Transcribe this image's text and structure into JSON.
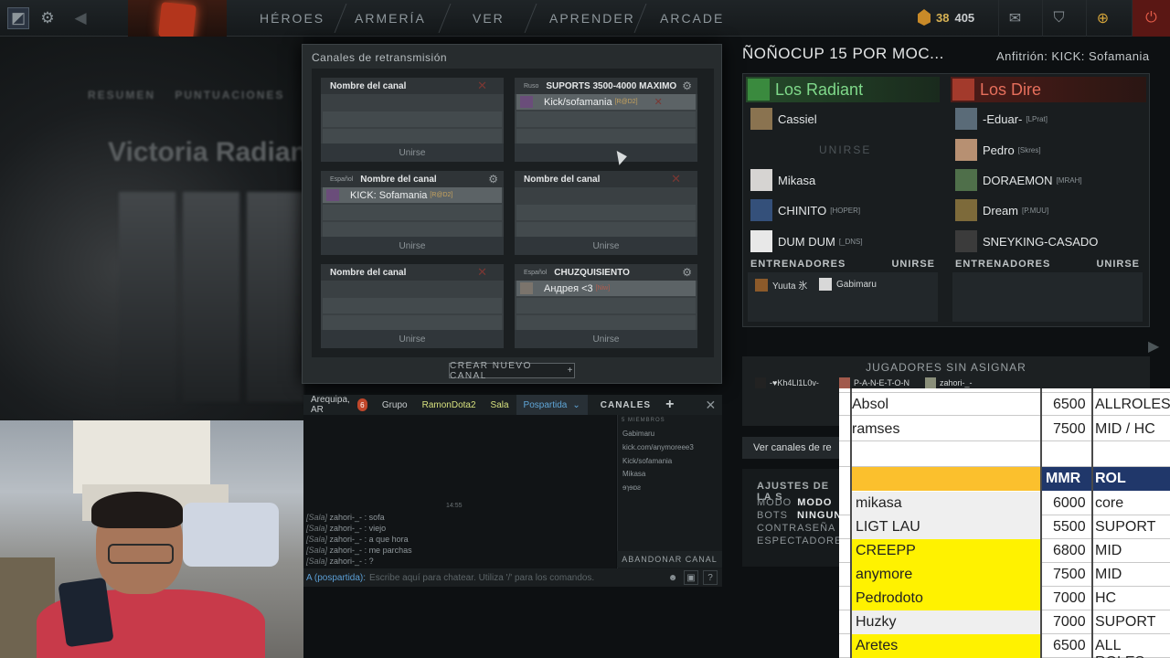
{
  "nav": {
    "items": [
      "HÉROES",
      "ARMERÍA",
      "VER",
      "APRENDER",
      "ARCADE"
    ],
    "gold": "38",
    "shards": "405"
  },
  "background": {
    "summary_label": "RESUMEN",
    "scores_label": "PUNTUACIONES",
    "victory_text": "Victoria Radiant"
  },
  "broadcast": {
    "title": "Canales de retransmisión",
    "join_label": "Unirse",
    "new_channel": "CREAR NUEVO CANAL",
    "channels": [
      {
        "lang": "",
        "name": "Nombre del canal",
        "member": "",
        "tag": ""
      },
      {
        "lang": "Ruso",
        "name": "SUPORTS 3500-4000 MAXIMO",
        "member": "Kick/sofamania",
        "tag": "[R@D2]"
      },
      {
        "lang": "Español",
        "name": "Nombre del canal",
        "member": "KICK: Sofamania",
        "tag": "[R@D2]"
      },
      {
        "lang": "",
        "name": "Nombre del canal",
        "member": "",
        "tag": ""
      },
      {
        "lang": "",
        "name": "Nombre del canal",
        "member": "",
        "tag": ""
      },
      {
        "lang": "Español",
        "name": "CHUZQUISIENTO",
        "member": "Андрея <3",
        "tag": "[Niw]"
      }
    ]
  },
  "chat": {
    "tabs": {
      "location": "Arequipa, AR",
      "badge": "6",
      "group": "Grupo",
      "friend": "RamonDota2",
      "room": "Sala",
      "active": "Pospartida"
    },
    "channels_label": "CANALES",
    "time": "14:55",
    "lines": [
      {
        "prefix": "[Sala]",
        "user": "zahori-_-",
        "text": ": sofa"
      },
      {
        "prefix": "[Sala]",
        "user": "zahori-_-",
        "text": ": viejo"
      },
      {
        "prefix": "[Sala]",
        "user": "zahori-_-",
        "text": ": a que hora"
      },
      {
        "prefix": "[Sala]",
        "user": "zahori-_-",
        "text": ": me parchas"
      },
      {
        "prefix": "[Sala]",
        "user": "zahori-_-",
        "text": ": ?"
      }
    ],
    "input_target": "A (pospartida):",
    "input_placeholder": "Escribe aquí para chatear. Utiliza '/' para los comandos.",
    "members_count": "5 MIEMBROS",
    "members": [
      "Gabimaru",
      "kick.com/anymoreee3",
      "Kick/sofamania",
      "Mikasa",
      "ɘɿɘɒƨ"
    ],
    "leave": "ABANDONAR CANAL"
  },
  "lobby": {
    "title": "ÑOÑOCUP 15 POR MOC...",
    "host": "Anfitrión: KICK: Sofamania",
    "radiant": {
      "name": "Los Radiant",
      "color": "#7fd98a",
      "players": [
        {
          "name": "Cassiel",
          "tag": ""
        },
        {
          "name": "UNIRSE",
          "tag": ""
        },
        {
          "name": "Mikasa",
          "tag": ""
        },
        {
          "name": "CHINITO",
          "tag": "[HOPER]"
        },
        {
          "name": "DUM DUM",
          "tag": "[_DNS]"
        }
      ],
      "coaches_label": "ENTRENADORES",
      "join": "UNIRSE",
      "coaches": [
        "Yuuta 氷",
        "Gabimaru"
      ]
    },
    "dire": {
      "name": "Los Dire",
      "color": "#e66f5c",
      "players": [
        {
          "name": "-Eduar-",
          "tag": "[LPrat]"
        },
        {
          "name": "Pedro",
          "tag": "[Skres]"
        },
        {
          "name": "DORAEMON",
          "tag": "[MRAH]"
        },
        {
          "name": "Dream",
          "tag": "[P.MUU]"
        },
        {
          "name": "SNEYKING-CASADO",
          "tag": ""
        }
      ],
      "coaches_label": "ENTRENADORES",
      "join": "UNIRSE"
    },
    "unassigned_label": "JUGADORES SIN ASIGNAR",
    "unassigned": [
      "-♥Kh4Ll1L0v-",
      "P-A-N-E-T-O-N",
      "zahori-_-"
    ],
    "view_channels": "Ver canales de re",
    "settings": {
      "title": "AJUSTES DE LA S",
      "mode_label": "MODO",
      "mode_value": "MODO",
      "bots_label": "BOTS",
      "bots_value": "NINGUNO",
      "password_label": "CONTRASEÑA",
      "spectators_label": "ESPECTADORES"
    }
  },
  "sheet": {
    "top_rows": [
      {
        "name": "Absol",
        "mmr": "6500",
        "rol": "ALLROLES"
      },
      {
        "name": "ramses",
        "mmr": "7500",
        "rol": "MID / HC"
      }
    ],
    "header": {
      "mmr": "MMR",
      "rol": "ROL"
    },
    "rows": [
      {
        "name": "mikasa",
        "mmr": "6000",
        "rol": "core",
        "highlight": false
      },
      {
        "name": "LIGT LAU",
        "mmr": "5500",
        "rol": "SUPORT",
        "highlight": false
      },
      {
        "name": "CREEPP",
        "mmr": "6800",
        "rol": "MID",
        "highlight": true
      },
      {
        "name": "anymore",
        "mmr": "7500",
        "rol": "MID",
        "highlight": true
      },
      {
        "name": "Pedrodoto",
        "mmr": "7000",
        "rol": "HC",
        "highlight": true
      },
      {
        "name": "Huzky",
        "mmr": "7000",
        "rol": "SUPORT",
        "highlight": false
      },
      {
        "name": "Aretes",
        "mmr": "6500",
        "rol": "ALL ROLES",
        "highlight": true
      }
    ]
  }
}
